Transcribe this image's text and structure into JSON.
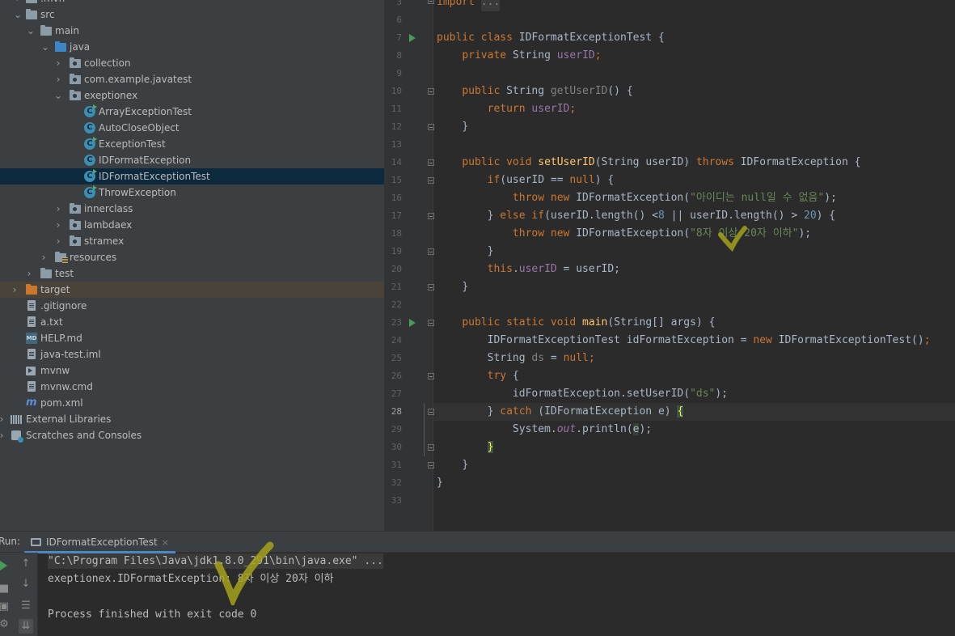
{
  "project_tree": [
    {
      "label": ".mvn",
      "depth": 1
    },
    {
      "label": "src",
      "depth": 1,
      "expanded": true
    },
    {
      "label": "main",
      "depth": 2,
      "expanded": true
    },
    {
      "label": "java",
      "depth": 3,
      "expanded": true
    },
    {
      "label": "collection",
      "depth": 4
    },
    {
      "label": "com.example.javatest",
      "depth": 4
    },
    {
      "label": "exeptionex",
      "depth": 4,
      "expanded": true
    },
    {
      "label": "ArrayExceptionTest",
      "depth": 5
    },
    {
      "label": "AutoCloseObject",
      "depth": 5
    },
    {
      "label": "ExceptionTest",
      "depth": 5
    },
    {
      "label": "IDFormatException",
      "depth": 5
    },
    {
      "label": "IDFormatExceptionTest",
      "depth": 5,
      "selected": true
    },
    {
      "label": "ThrowException",
      "depth": 5
    },
    {
      "label": "innerclass",
      "depth": 4
    },
    {
      "label": "lambdaex",
      "depth": 4
    },
    {
      "label": "stramex",
      "depth": 4
    },
    {
      "label": "resources",
      "depth": 3
    },
    {
      "label": "test",
      "depth": 2
    },
    {
      "label": "target",
      "depth": 1
    },
    {
      "label": ".gitignore",
      "depth": 1
    },
    {
      "label": "a.txt",
      "depth": 1
    },
    {
      "label": "HELP.md",
      "depth": 1
    },
    {
      "label": "java-test.iml",
      "depth": 1
    },
    {
      "label": "mvnw",
      "depth": 1
    },
    {
      "label": "mvnw.cmd",
      "depth": 1
    },
    {
      "label": "pom.xml",
      "depth": 1
    },
    {
      "label": "External Libraries",
      "depth": 0
    },
    {
      "label": "Scratches and Consoles",
      "depth": 0
    }
  ],
  "icons": {
    "md_icon_text": "MD",
    "maven_icon_text": "m",
    "class_icon_text": "C",
    "play_glyph": "▶",
    "chevron_right": "›",
    "chevron_down": "⌄",
    "up_arrow": "↑",
    "down_arrow": "↓",
    "wrap_glyph": "☰",
    "scroll_glyph": "⇊",
    "camera_glyph": "▣",
    "stop_glyph": "■",
    "wrench_glyph": "⚙"
  },
  "editor": {
    "line_numbers": [
      "3",
      "6",
      "7",
      "8",
      "9",
      "10",
      "11",
      "12",
      "13",
      "14",
      "15",
      "16",
      "17",
      "18",
      "19",
      "20",
      "21",
      "22",
      "23",
      "24",
      "25",
      "26",
      "27",
      "28",
      "29",
      "30",
      "31",
      "32",
      "33"
    ],
    "active_line": "28",
    "lines": {
      "l3_import": "import",
      "l3_ellipsis": "...",
      "l7_public": "public",
      "l7_class": "class",
      "l7_name": "IDFormatExceptionTest {",
      "l8_private": "private",
      "l8_type": "String",
      "l8_field": "userID",
      "l8_semi": ";",
      "l10_public": "public",
      "l10_type": "String",
      "l10_method": "getUserID",
      "l10_rest": "() {",
      "l11_return": "return",
      "l11_field": "userID",
      "l11_semi": ";",
      "l12": "}",
      "l14_public": "public",
      "l14_void": "void",
      "l14_method": "setUserID",
      "l14_params": "(String userID)",
      "l14_throws": "throws",
      "l14_rest": "IDFormatException {",
      "l15_if": "if",
      "l15_cond": "(userID ==",
      "l15_null": "null",
      "l15_rest": ") {",
      "l16_throw": "throw",
      "l16_new": "new",
      "l16_cls": "IDFormatException(",
      "l16_str": "\"아이디는 null일 수 없음\"",
      "l16_end": ");",
      "l17_brace": "}",
      "l17_else": "else if",
      "l17_cond1": "(userID.length() <",
      "l17_num1": "8",
      "l17_cond2": "|| userID.length() >",
      "l17_num2": "20",
      "l17_rest": ") {",
      "l18_throw": "throw",
      "l18_new": "new",
      "l18_cls": "IDFormatException(",
      "l18_str": "\"8자 이상 20자 이하\"",
      "l18_end": ");",
      "l19": "}",
      "l20_this": "this",
      "l20_dot": ".",
      "l20_field": "userID",
      "l20_rest": " = userID;",
      "l21": "}",
      "l23_public": "public",
      "l23_static": "static",
      "l23_void": "void",
      "l23_method": "main",
      "l23_rest": "(String[] args) {",
      "l24_decl": "IDFormatExceptionTest idFormatException =",
      "l24_new": "new",
      "l24_rest": "IDFormatExceptionTest()",
      "l24_semi": ";",
      "l25_type": "String",
      "l25_var": "ds",
      "l25_eq": " =",
      "l25_null": "null",
      "l25_semi": ";",
      "l26_try": "try",
      "l26_rest": " {",
      "l27_call": "idFormatException.setUserID(",
      "l27_str": "\"ds\"",
      "l27_end": ");",
      "l28_brace": "}",
      "l28_catch": "catch",
      "l28_params": "(IDFormatException e)",
      "l28_open": "{",
      "l29_sys": "System.",
      "l29_out": "out",
      "l29_print": ".println(",
      "l29_e": "e",
      "l29_end": ");",
      "l30": "}",
      "l31": "}",
      "l32": "}"
    }
  },
  "run_window": {
    "label": "Run:",
    "tab_title": "IDFormatExceptionTest",
    "tab_close": "×",
    "console": [
      "\"C:\\Program Files\\Java\\jdk1.8.0_291\\bin\\java.exe\" ...",
      "exeptionex.IDFormatException: 8자 이상 20자 이하",
      "",
      "Process finished with exit code 0"
    ]
  },
  "colors": {
    "keyword": "#cc7832",
    "field": "#9876aa",
    "string": "#6a8759",
    "number": "#6897bb",
    "method_decl": "#ffc66d",
    "selection": "#0d293e",
    "accent_tab": "#4a88c7"
  }
}
